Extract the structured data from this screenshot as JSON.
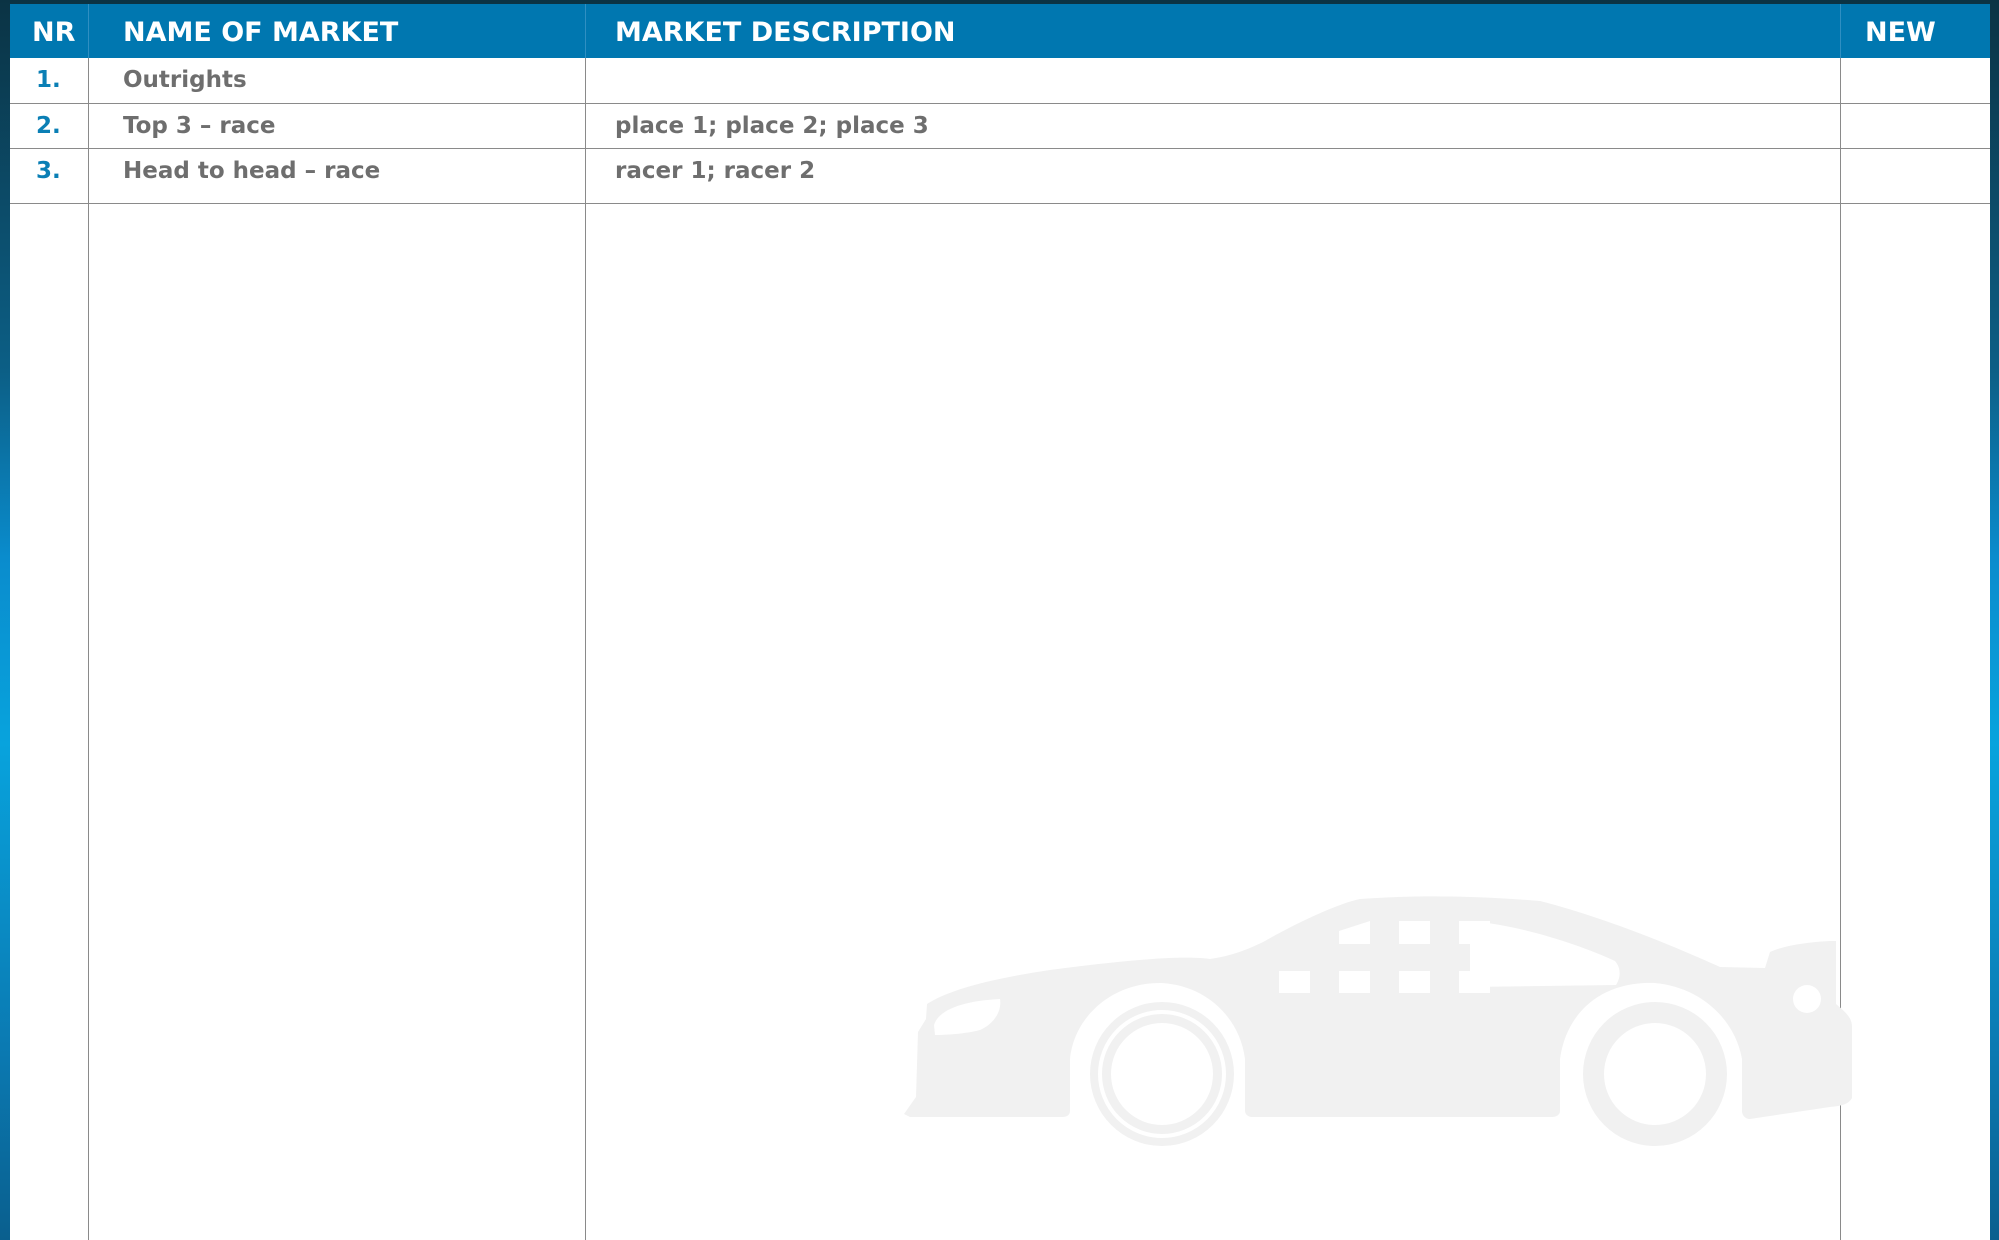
{
  "table": {
    "columns": [
      "NR",
      "NAME OF MARKET",
      "MARKET DESCRIPTION",
      "NEW"
    ],
    "rows": [
      {
        "nr": "1.",
        "name": "Outrights",
        "description": "",
        "new": ""
      },
      {
        "nr": "2.",
        "name": "Top 3 – race",
        "description": "place 1; place 2; place 3",
        "new": ""
      },
      {
        "nr": "3.",
        "name": "Head to head – race",
        "description": "racer 1; racer 2",
        "new": ""
      }
    ]
  },
  "watermark": {
    "icon": "race-car-icon"
  },
  "colors": {
    "header": "#0077b0",
    "number": "#0a7fb5",
    "text": "#6e6e6e",
    "watermark": "#f1f1f1"
  }
}
